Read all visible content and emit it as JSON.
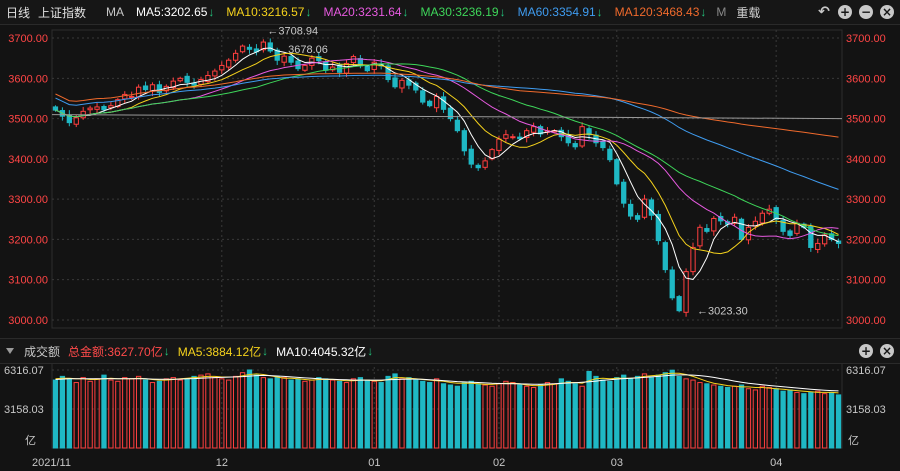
{
  "top": {
    "period": "日线",
    "index": "上证指数",
    "ma": "MA",
    "items": [
      {
        "label": "MA5:3202.65",
        "arrow": "↓",
        "color": "#ffffff",
        "acolor": "#22c07a"
      },
      {
        "label": "MA10:3216.57",
        "arrow": "↓",
        "color": "#f5d21c",
        "acolor": "#22c07a"
      },
      {
        "label": "MA20:3231.64",
        "arrow": "↓",
        "color": "#e75ae0",
        "acolor": "#22c07a"
      },
      {
        "label": "MA30:3236.19",
        "arrow": "↓",
        "color": "#3ed65a",
        "acolor": "#22c07a"
      },
      {
        "label": "MA60:3354.91",
        "arrow": "↓",
        "color": "#3f9cf0",
        "acolor": "#22c07a"
      },
      {
        "label": "MA120:3468.43",
        "arrow": "↓",
        "color": "#f06a2c",
        "acolor": "#22c07a"
      }
    ],
    "truncated": "M",
    "adjust": "重载"
  },
  "volbar": {
    "label": "成交额",
    "total": "总金额:3627.70亿",
    "total_color": "#ff4a4a",
    "ma5": "MA5:3884.12亿",
    "ma5_color": "#f5d21c",
    "ma10": "MA10:4045.32亿",
    "ma10_color": "#ffffff",
    "arrow": "↓",
    "arrow_color": "#22c07a"
  },
  "icons": [
    "undo-icon",
    "zoom-in-icon",
    "zoom-out-icon",
    "close-icon"
  ],
  "colors": {
    "up": "#ff3f3f",
    "down": "#1fb8c4",
    "grid": "#3a3a3a"
  },
  "chart_data": {
    "type": "candlestick",
    "ylim": [
      2980,
      3720
    ],
    "y_ticks": [
      "3700.00",
      "3600.00",
      "3500.00",
      "3400.00",
      "3300.00",
      "3200.00",
      "3100.00",
      "3000.00"
    ],
    "y_tick_values": [
      3700,
      3600,
      3500,
      3400,
      3300,
      3200,
      3100,
      3000
    ],
    "x_labels": [
      "2021/11",
      "12",
      "01",
      "02",
      "03",
      "04"
    ],
    "x_label_index": [
      0,
      24,
      46,
      64,
      81,
      104
    ],
    "annotations": [
      {
        "text": "3708.94",
        "index": 30,
        "value": 3708.94
      },
      {
        "text": "3678.06",
        "index": 33,
        "value": 3678.06
      },
      {
        "text": "3023.30",
        "index": 92,
        "value": 3023.3
      }
    ],
    "closes": [
      3521,
      3506,
      3490,
      3502,
      3518,
      3526,
      3529,
      3522,
      3532,
      3547,
      3560,
      3555,
      3578,
      3572,
      3584,
      3565,
      3580,
      3593,
      3600,
      3590,
      3583,
      3597,
      3607,
      3618,
      3632,
      3645,
      3662,
      3680,
      3672,
      3666,
      3690,
      3668,
      3645,
      3655,
      3640,
      3624,
      3632,
      3650,
      3644,
      3620,
      3628,
      3615,
      3637,
      3654,
      3631,
      3619,
      3640,
      3631,
      3597,
      3579,
      3595,
      3583,
      3571,
      3541,
      3532,
      3555,
      3523,
      3500,
      3470,
      3420,
      3387,
      3378,
      3395,
      3423,
      3449,
      3460,
      3455,
      3450,
      3470,
      3480,
      3462,
      3470,
      3470,
      3455,
      3440,
      3430,
      3480,
      3460,
      3440,
      3428,
      3398,
      3338,
      3290,
      3258,
      3250,
      3300,
      3260,
      3197,
      3125,
      3055,
      3023,
      3120,
      3180,
      3230,
      3220,
      3252,
      3246,
      3238,
      3255,
      3200,
      3230,
      3245,
      3265,
      3275,
      3250,
      3220,
      3210,
      3240,
      3230,
      3180,
      3190,
      3211,
      3200,
      3190
    ],
    "volume": {
      "labels": [
        "6316.07",
        "3158.03",
        "亿"
      ],
      "max": 6316.07,
      "values": [
        5500,
        5800,
        5600,
        5300,
        5700,
        5400,
        5600,
        5900,
        5500,
        5400,
        5700,
        5600,
        5800,
        5500,
        5300,
        5400,
        5600,
        5700,
        5500,
        5600,
        5800,
        5900,
        6000,
        5700,
        5600,
        5500,
        5800,
        6100,
        6316,
        5900,
        5700,
        5600,
        5800,
        5700,
        5500,
        5600,
        5400,
        5500,
        5700,
        5600,
        5500,
        5400,
        5300,
        5600,
        5700,
        5500,
        5400,
        5300,
        5800,
        6000,
        5600,
        5700,
        5500,
        5400,
        5300,
        5600,
        5200,
        5100,
        5000,
        5300,
        5400,
        5200,
        5100,
        5000,
        5200,
        5400,
        5300,
        5100,
        5000,
        4900,
        5100,
        5300,
        5200,
        5600,
        5400,
        5200,
        5000,
        6200,
        5800,
        5500,
        5400,
        5700,
        5900,
        5600,
        5800,
        6000,
        5700,
        5900,
        6100,
        6300,
        5800,
        5600,
        5500,
        5300,
        5200,
        5100,
        5000,
        4900,
        5000,
        5100,
        4800,
        4700,
        5000,
        4900,
        4800,
        4600,
        4700,
        4500,
        4400,
        4500,
        4600,
        4400,
        4500,
        4300
      ],
      "ma5": [
        5600,
        5650,
        5650,
        5600,
        5600,
        5550,
        5550,
        5600,
        5650,
        5600,
        5600,
        5600,
        5650,
        5600,
        5550,
        5500,
        5500,
        5550,
        5600,
        5650,
        5700,
        5750,
        5800,
        5800,
        5750,
        5750,
        5750,
        5850,
        5950,
        6000,
        5950,
        5850,
        5750,
        5650,
        5650,
        5600,
        5550,
        5500,
        5550,
        5550,
        5550,
        5500,
        5450,
        5450,
        5500,
        5500,
        5450,
        5450,
        5550,
        5700,
        5700,
        5650,
        5600,
        5550,
        5500,
        5450,
        5400,
        5300,
        5250,
        5250,
        5250,
        5200,
        5150,
        5150,
        5200,
        5250,
        5250,
        5200,
        5100,
        5050,
        5050,
        5100,
        5150,
        5250,
        5300,
        5300,
        5250,
        5450,
        5600,
        5650,
        5600,
        5650,
        5650,
        5650,
        5700,
        5800,
        5850,
        5900,
        6000,
        6050,
        6050,
        5950,
        5800,
        5600,
        5400,
        5250,
        5150,
        5050,
        5000,
        4950,
        4950,
        4900,
        4900,
        4850,
        4800,
        4750,
        4700,
        4650,
        4600,
        4550,
        4500,
        4500,
        4500,
        4460
      ],
      "ma10": [
        5550,
        5580,
        5600,
        5600,
        5600,
        5600,
        5600,
        5600,
        5600,
        5600,
        5600,
        5600,
        5600,
        5600,
        5580,
        5560,
        5560,
        5560,
        5580,
        5600,
        5620,
        5650,
        5680,
        5700,
        5720,
        5740,
        5760,
        5780,
        5820,
        5860,
        5880,
        5860,
        5830,
        5800,
        5760,
        5720,
        5680,
        5640,
        5600,
        5580,
        5560,
        5540,
        5520,
        5500,
        5500,
        5500,
        5500,
        5500,
        5520,
        5550,
        5570,
        5580,
        5580,
        5560,
        5530,
        5500,
        5460,
        5420,
        5380,
        5350,
        5330,
        5300,
        5270,
        5240,
        5220,
        5210,
        5200,
        5190,
        5180,
        5170,
        5170,
        5180,
        5200,
        5230,
        5260,
        5290,
        5320,
        5360,
        5420,
        5480,
        5530,
        5580,
        5620,
        5650,
        5680,
        5720,
        5760,
        5800,
        5850,
        5900,
        5920,
        5920,
        5900,
        5860,
        5800,
        5720,
        5620,
        5520,
        5420,
        5330,
        5250,
        5180,
        5120,
        5060,
        5010,
        4960,
        4910,
        4860,
        4810,
        4760,
        4720,
        4680,
        4650,
        4620
      ]
    }
  }
}
